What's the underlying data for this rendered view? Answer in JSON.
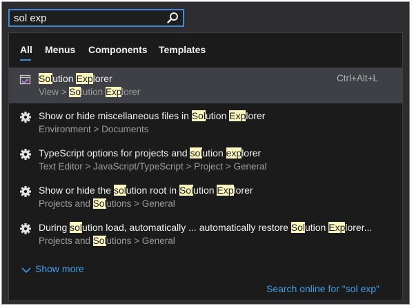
{
  "search": {
    "value": "sol exp"
  },
  "tabs": [
    {
      "label": "All",
      "active": true
    },
    {
      "label": "Menus",
      "active": false
    },
    {
      "label": "Components",
      "active": false
    },
    {
      "label": "Templates",
      "active": false
    }
  ],
  "results": [
    {
      "icon": "vs-solution-explorer-icon",
      "title": [
        {
          "t": "Sol",
          "h": true
        },
        {
          "t": "ution ",
          "h": false
        },
        {
          "t": "Exp",
          "h": true
        },
        {
          "t": "lorer",
          "h": false
        }
      ],
      "path": [
        {
          "t": "View > ",
          "h": false
        },
        {
          "t": "So",
          "h": true
        },
        {
          "t": "lution ",
          "h": false
        },
        {
          "t": "Exp",
          "h": true
        },
        {
          "t": "lorer",
          "h": false
        }
      ],
      "shortcut": "Ctrl+Alt+L",
      "selected": true
    },
    {
      "icon": "gear-icon",
      "title": [
        {
          "t": "Show or hide miscellaneous files in ",
          "h": false
        },
        {
          "t": "Sol",
          "h": true
        },
        {
          "t": "ution ",
          "h": false
        },
        {
          "t": "Exp",
          "h": true
        },
        {
          "t": "lorer",
          "h": false
        }
      ],
      "path": [
        {
          "t": "Environment > Documents",
          "h": false
        }
      ],
      "shortcut": "",
      "selected": false
    },
    {
      "icon": "gear-icon",
      "title": [
        {
          "t": "TypeScript options for projects and ",
          "h": false
        },
        {
          "t": "sol",
          "h": true
        },
        {
          "t": "ution ",
          "h": false
        },
        {
          "t": "exp",
          "h": true
        },
        {
          "t": "lorer",
          "h": false
        }
      ],
      "path": [
        {
          "t": "Text Editor > JavaScript/TypeScript > Project > General",
          "h": false
        }
      ],
      "shortcut": "",
      "selected": false
    },
    {
      "icon": "gear-icon",
      "title": [
        {
          "t": "Show or hide the ",
          "h": false
        },
        {
          "t": "sol",
          "h": true
        },
        {
          "t": "ution root in ",
          "h": false
        },
        {
          "t": "Sol",
          "h": true
        },
        {
          "t": "ution ",
          "h": false
        },
        {
          "t": "Exp",
          "h": true
        },
        {
          "t": "lorer",
          "h": false
        }
      ],
      "path": [
        {
          "t": "Projects and ",
          "h": false
        },
        {
          "t": "Sol",
          "h": true
        },
        {
          "t": "utions > General",
          "h": false
        }
      ],
      "shortcut": "",
      "selected": false
    },
    {
      "icon": "gear-icon",
      "title": [
        {
          "t": "During ",
          "h": false
        },
        {
          "t": "sol",
          "h": true
        },
        {
          "t": "ution load, automatically ... automatically restore ",
          "h": false
        },
        {
          "t": "Sol",
          "h": true
        },
        {
          "t": "ution ",
          "h": false
        },
        {
          "t": "Exp",
          "h": true
        },
        {
          "t": "lorer...",
          "h": false
        }
      ],
      "path": [
        {
          "t": "Projects and ",
          "h": false
        },
        {
          "t": "Sol",
          "h": true
        },
        {
          "t": "utions > General",
          "h": false
        }
      ],
      "shortcut": "",
      "selected": false
    }
  ],
  "show_more": "Show more",
  "search_online": "Search online for \"sol exp\"",
  "colors": {
    "accent": "#3e8ad6",
    "link": "#3e9ee8",
    "highlight": "#fff7c1",
    "selected_row": "#3f3f46",
    "panel_bg": "#1b1b1c",
    "window_bg": "#2d2d30"
  }
}
